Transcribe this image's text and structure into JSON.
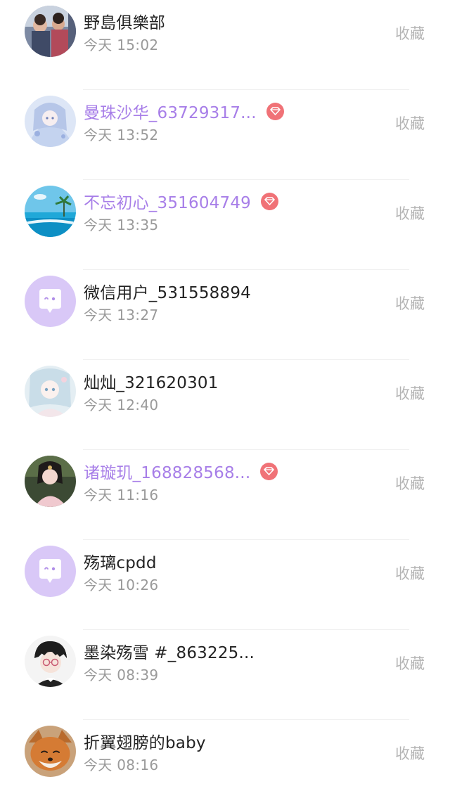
{
  "contacts": [
    {
      "name": "野島俱樂部",
      "time": "今天 15:02",
      "vip": false,
      "avatar": "group-photo",
      "action": "收藏"
    },
    {
      "name": "曼珠沙华_63729317...",
      "time": "今天 13:52",
      "vip": true,
      "avatar": "anime-girl-blue",
      "action": "收藏"
    },
    {
      "name": "不忘初心_351604749",
      "time": "今天 13:35",
      "vip": true,
      "avatar": "beach-scenery",
      "action": "收藏"
    },
    {
      "name": "微信用户_531558894",
      "time": "今天 13:27",
      "vip": false,
      "avatar": "default-chat-avatar",
      "action": "收藏"
    },
    {
      "name": "灿灿_321620301",
      "time": "今天 12:40",
      "vip": false,
      "avatar": "anime-girl-pale",
      "action": "收藏"
    },
    {
      "name": "诸璇玑_168828568...",
      "time": "今天 11:16",
      "vip": true,
      "avatar": "costume-portrait",
      "action": "收藏"
    },
    {
      "name": "殇璃cpdd",
      "time": "今天 10:26",
      "vip": false,
      "avatar": "default-chat-avatar",
      "action": "收藏"
    },
    {
      "name": "墨染殇雪 #_863225...",
      "time": "今天 08:39",
      "vip": false,
      "avatar": "anime-boy-glasses",
      "action": "收藏"
    },
    {
      "name": "折翼翅膀的baby",
      "time": "今天 08:16",
      "vip": false,
      "avatar": "fox-photo",
      "action": "收藏"
    }
  ],
  "colors": {
    "vip_name": "#a77ee8",
    "normal_name": "#222222",
    "time": "#9a9a9a",
    "action": "#b4b4b4",
    "vip_badge": "#f07277",
    "default_avatar_bg": "#d9c8f7"
  }
}
